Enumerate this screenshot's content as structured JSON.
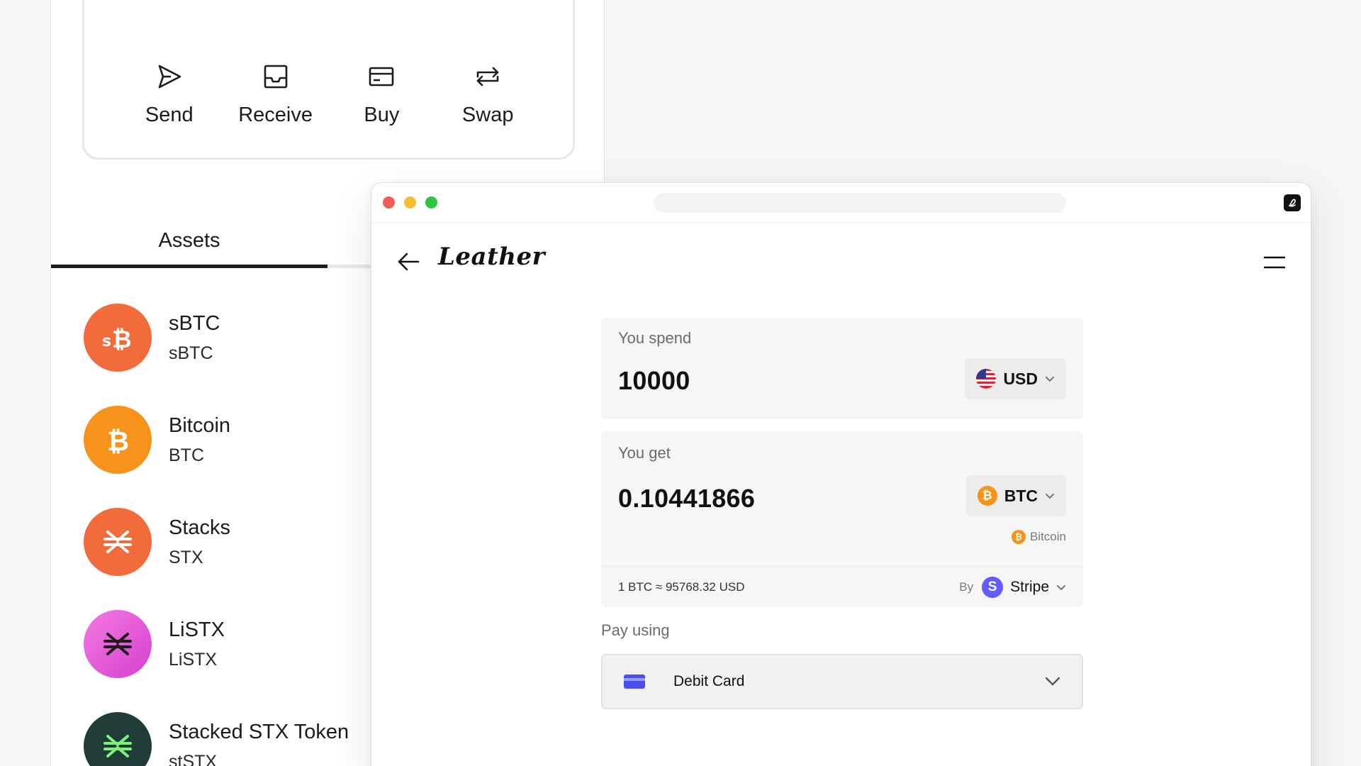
{
  "wallet": {
    "actions": [
      {
        "label": "Send",
        "icon": "send-icon"
      },
      {
        "label": "Receive",
        "icon": "inbox-icon"
      },
      {
        "label": "Buy",
        "icon": "credit-card-icon"
      },
      {
        "label": "Swap",
        "icon": "swap-icon"
      }
    ],
    "tabs": [
      {
        "label": "Assets",
        "active": true
      }
    ],
    "assets": [
      {
        "name": "sBTC",
        "symbol": "sBTC",
        "color": "#f26b3a"
      },
      {
        "name": "Bitcoin",
        "symbol": "BTC",
        "color": "#f7931a"
      },
      {
        "name": "Stacks",
        "symbol": "STX",
        "color": "#f26b3a"
      },
      {
        "name": "LiSTX",
        "symbol": "LiSTX",
        "color": "#e84fd2"
      },
      {
        "name": "Stacked STX Token",
        "symbol": "stSTX",
        "color": "#1f3d36"
      }
    ]
  },
  "app": {
    "logo": "Leather",
    "spend": {
      "label": "You spend",
      "amount": "10000",
      "currency": "USD"
    },
    "get": {
      "label": "You get",
      "amount": "0.10441866",
      "currency": "BTC",
      "network": "Bitcoin"
    },
    "rate": "1 BTC ≈ 95768.32 USD",
    "provider": {
      "prefix": "By",
      "name": "Stripe"
    },
    "pay": {
      "label": "Pay using",
      "method": "Debit Card"
    }
  },
  "colors": {
    "bitcoin": "#f7931a",
    "stripe": "#635bff",
    "text": "#1b1b1b"
  }
}
